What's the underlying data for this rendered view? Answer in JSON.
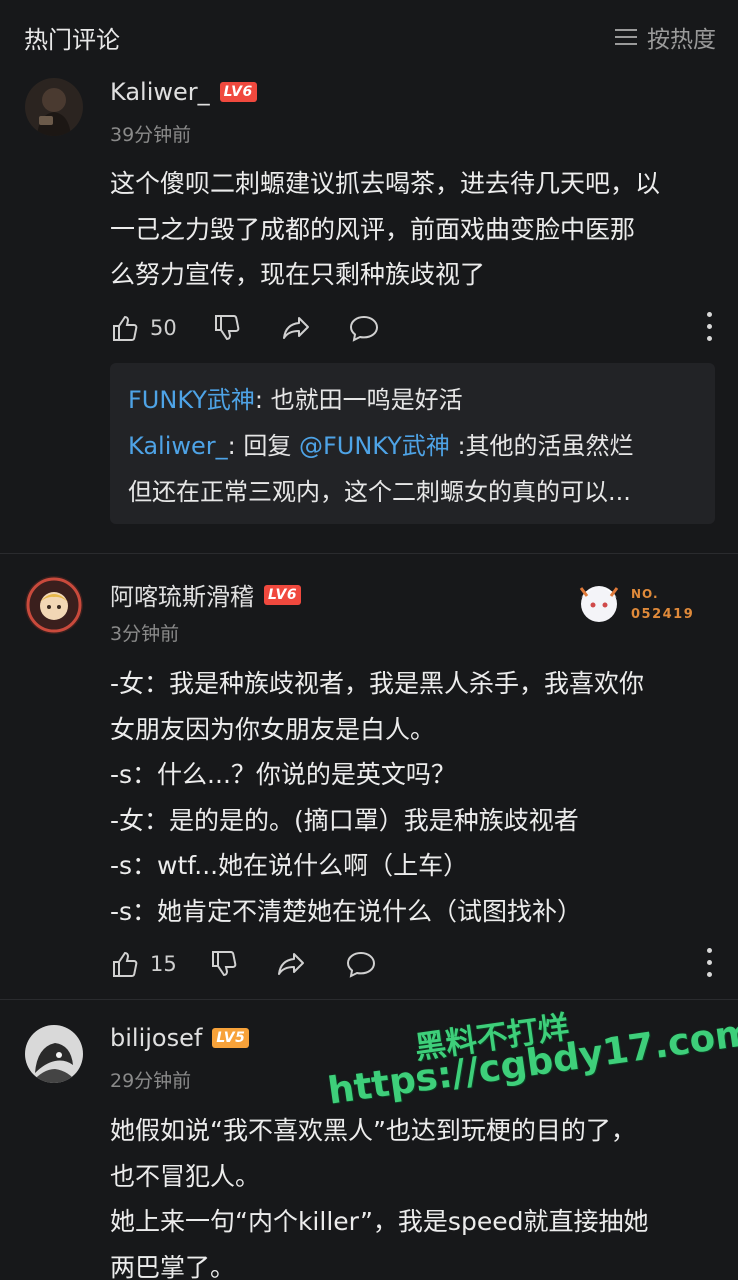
{
  "header": {
    "title": "热门评论",
    "sort_label": "按热度",
    "sort_icon": "menu-lines-icon"
  },
  "comments": [
    {
      "username": "Kaliwer_",
      "level": "LV6",
      "time": "39分钟前",
      "text": "这个傻呗二刺螈建议抓去喝茶，进去待几天吧，以\n一己之力毁了成都的风评，前面戏曲变脸中医那\n么努力宣传，现在只剩种族歧视了",
      "likes": "50",
      "replies": [
        {
          "name": "FUNKY武神",
          "text": ": 也就田一鸣是好活"
        },
        {
          "name": "Kaliwer_",
          "text_pre": ": 回复 ",
          "mention": "@FUNKY武神",
          "text": " :其他的活虽然烂",
          "text2": "但还在正常三观内，这个二刺螈女的真的可以..."
        }
      ]
    },
    {
      "username": "阿喀琉斯滑稽",
      "level": "LV6",
      "time": "3分钟前",
      "badge_no_label": "NO.",
      "badge_no_value": "052419",
      "text": "-女：我是种族歧视者，我是黑人杀手，我喜欢你\n女朋友因为你女朋友是白人。\n-s：什么...？你说的是英文吗？\n-女：是的是的。(摘口罩）我是种族歧视者\n-s：wtf...她在说什么啊（上车）\n-s：她肯定不清楚她在说什么（试图找补）",
      "likes": "15"
    },
    {
      "username": "bilijosef",
      "level": "LV5",
      "time": "29分钟前",
      "text": "她假如说“我不喜欢黑人”也达到玩梗的目的了，\n也不冒犯人。\n她上来一句“内个killer”，我是speed就直接抽她\n两巴掌了。"
    }
  ],
  "watermark": {
    "line1": "黑料不打烊",
    "line2": "https://cgbdy17.com"
  },
  "colors": {
    "lv6": "#f0493e",
    "lv5": "#f7a23a",
    "link": "#4ea3e6",
    "watermark": "#3ecf7a"
  }
}
